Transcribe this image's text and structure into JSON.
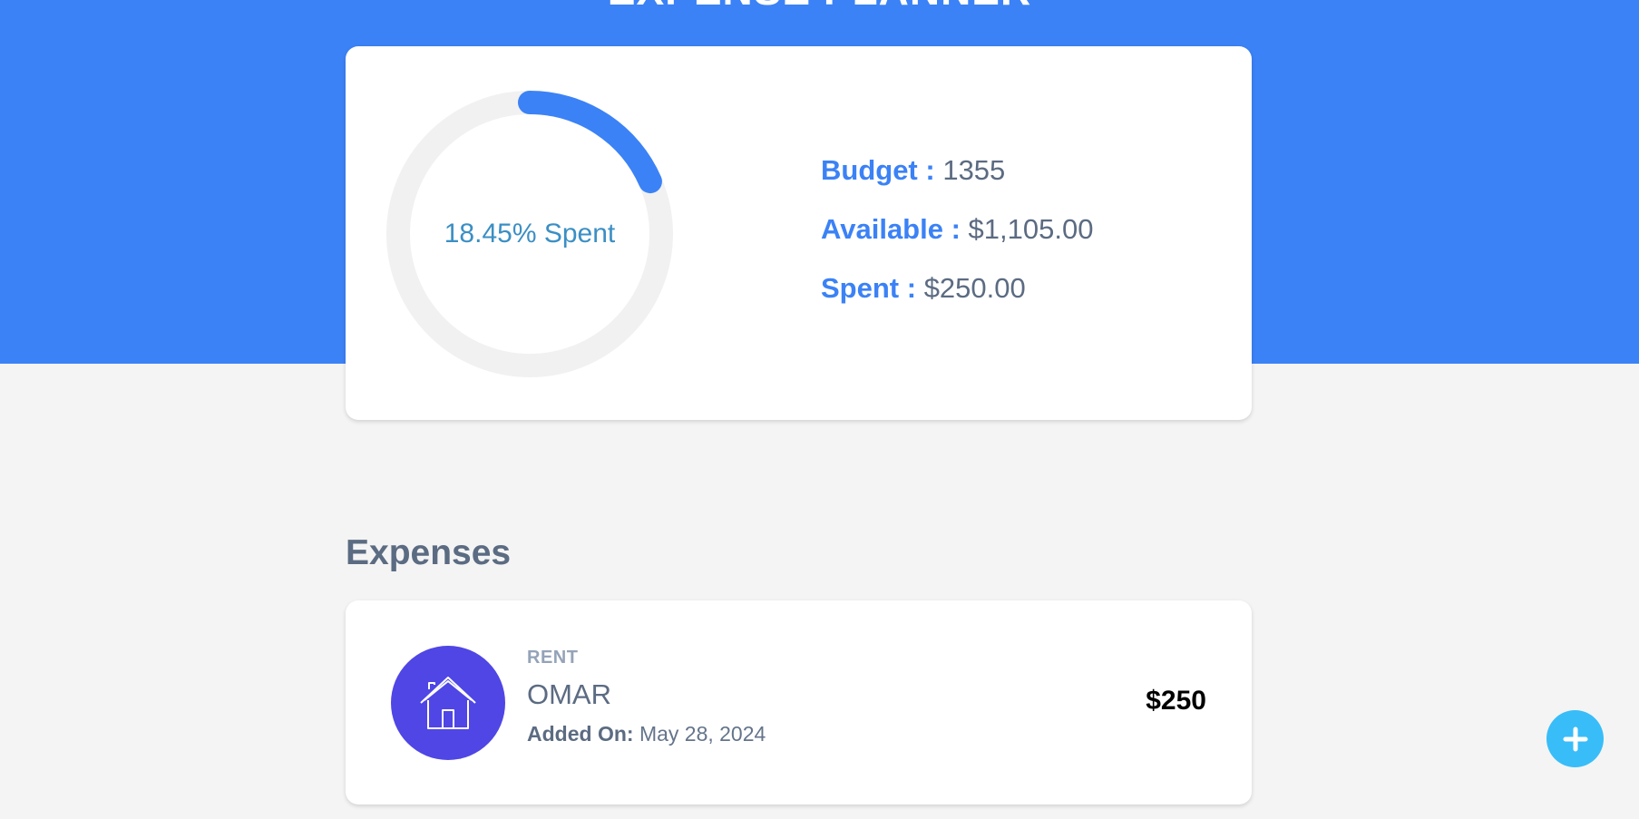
{
  "header": {
    "title": "EXPENSE PLANNER"
  },
  "summary": {
    "progress_label": "18.45% Spent",
    "progress_fraction": 0.1845,
    "budget_label": "Budget :",
    "budget_value": "1355",
    "available_label": "Available :",
    "available_value": "$1,105.00",
    "spent_label": "Spent :",
    "spent_value": "$250.00"
  },
  "expenses": {
    "title": "Expenses",
    "items": [
      {
        "category": "RENT",
        "name": "OMAR",
        "date_label": "Added On:",
        "date_value": "May 28, 2024",
        "amount": "$250",
        "icon": "house-icon"
      }
    ]
  },
  "fab": {
    "icon": "plus-icon"
  },
  "colors": {
    "primary": "#3b82f6",
    "background": "#f4f4f4",
    "expense_icon_bg": "#4f46e5",
    "fab": "#38bdf8",
    "progress_track": "#f1f1f1"
  }
}
